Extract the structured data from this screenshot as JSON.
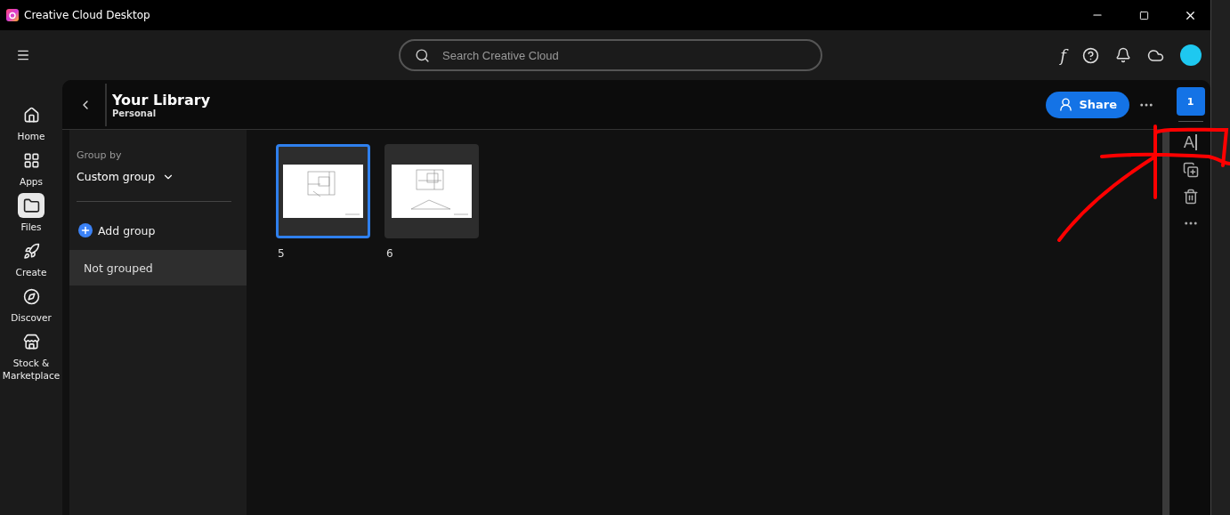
{
  "window": {
    "title": "Creative Cloud Desktop"
  },
  "search": {
    "placeholder": "Search Creative Cloud"
  },
  "fonts_button": "f",
  "nav": [
    {
      "label": "Home",
      "selected": false
    },
    {
      "label": "Apps",
      "selected": false
    },
    {
      "label": "Files",
      "selected": true
    },
    {
      "label": "Create",
      "selected": false
    },
    {
      "label": "Discover",
      "selected": false
    },
    {
      "label": "Stock & Marketplace",
      "selected": false
    }
  ],
  "library": {
    "title": "Your Library",
    "subtitle": "Personal",
    "share": "Share"
  },
  "group_panel": {
    "label": "Group by",
    "value": "Custom group",
    "add": "Add group",
    "groups": [
      {
        "label": "Not grouped",
        "selected": true
      }
    ]
  },
  "assets": [
    {
      "name": "5",
      "selected": true,
      "kind": "plan"
    },
    {
      "name": "6",
      "selected": false,
      "kind": "plan-elevation"
    }
  ],
  "rail": {
    "count": "1",
    "rename": "A"
  }
}
